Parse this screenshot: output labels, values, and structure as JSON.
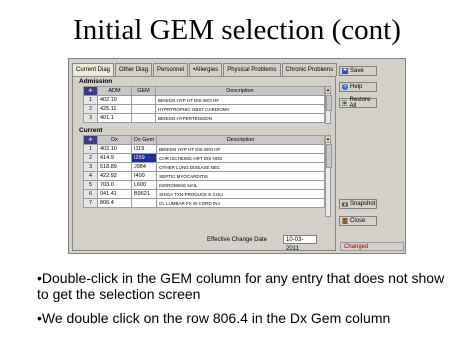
{
  "slide": {
    "title": "Initial GEM selection (cont)",
    "bullets": [
      "•Double-click in the GEM column for any entry that does not show to get the selection screen",
      "•We double click on the row 806.4 in the Dx Gem column"
    ]
  },
  "tabs": [
    "Current Diag",
    "Other Diag",
    "Personnel",
    "•Allergies",
    "Physical Problems",
    "Chronic Problems"
  ],
  "admission": {
    "label": "Admission",
    "headers": [
      "ADM",
      "GEM",
      "Description"
    ],
    "rows": [
      {
        "n": "1",
        "code": "402.10",
        "gem": "",
        "desc": "BENIGN HYP HT DIS W/O HF"
      },
      {
        "n": "2",
        "code": "425.11",
        "gem": "",
        "desc": "HYPRTROPHIC OBST CARDIOMY"
      },
      {
        "n": "3",
        "code": "401.1",
        "gem": "",
        "desc": "BENIGN HYPERTENSION"
      }
    ]
  },
  "current": {
    "label": "Current",
    "headers": [
      "Dx",
      "Dx Gem",
      "Description"
    ],
    "rows": [
      {
        "n": "1",
        "code": "402.10",
        "gem": "I119",
        "desc": "BENIGN HYP HT DIS W/O HF"
      },
      {
        "n": "2",
        "code": "414.9",
        "gem": "I259",
        "desc": "CHR ISCHEMIC HRT DIS NOS"
      },
      {
        "n": "3",
        "code": "518.89",
        "gem": "J984",
        "desc": "OTHER LUNG DISEASE NEC"
      },
      {
        "n": "4",
        "code": "422.92",
        "gem": "I400",
        "desc": "SEPTIC MYOCARDITIS"
      },
      {
        "n": "5",
        "code": "703.0",
        "gem": "L600",
        "desc": "INGROWING NAIL"
      },
      {
        "n": "6",
        "code": "041.41",
        "gem": "B9621",
        "desc": "SHIGA TXN-PRODUCE E.COLI"
      },
      {
        "n": "7",
        "code": "806.4",
        "gem": "",
        "desc": "CL LUMBAR FX W CORD INJ"
      }
    ]
  },
  "effective": {
    "label": "Effective Change Date",
    "value": "10-03-2011"
  },
  "buttons": {
    "save": "Save",
    "help": "Help",
    "restore": "Restore All",
    "snapshot": "Snapshot",
    "close": "Close"
  },
  "status": "Changed",
  "colors": {
    "selected_cell": "#1c2f9e",
    "status_text": "#b00000"
  }
}
